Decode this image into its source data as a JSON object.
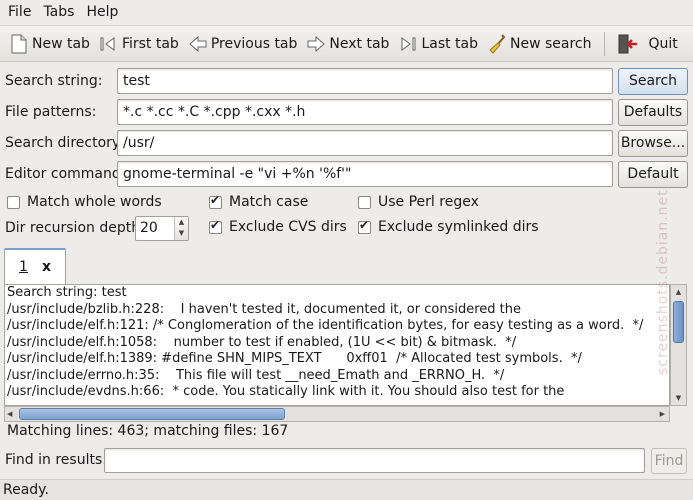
{
  "menubar": {
    "items": [
      {
        "label": "File"
      },
      {
        "label": "Tabs"
      },
      {
        "label": "Help"
      }
    ]
  },
  "toolbar": {
    "new_tab": "New tab",
    "first_tab": "First tab",
    "previous_tab": "Previous tab",
    "next_tab": "Next tab",
    "last_tab": "Last tab",
    "new_search": "New search",
    "quit": "Quit"
  },
  "form": {
    "search_string_label": "Search string:",
    "search_string_value": "test",
    "search_button": "Search",
    "file_patterns_label": "File patterns:",
    "file_patterns_value": "*.c *.cc *.C *.cpp *.cxx *.h",
    "defaults_button": "Defaults",
    "search_directory_label": "Search directory:",
    "search_directory_value": "/usr/",
    "browse_button": "Browse...",
    "editor_command_label": "Editor command:",
    "editor_command_value": "gnome-terminal -e \"vi +%n '%f'\"",
    "default_button": "Default"
  },
  "options": {
    "match_whole_words": {
      "label": "Match whole words",
      "checked": false
    },
    "match_case": {
      "label": "Match case",
      "checked": true
    },
    "use_perl_regex": {
      "label": "Use Perl regex",
      "checked": false
    },
    "recursion_label": "Dir recursion depth:",
    "recursion_value": "20",
    "exclude_cvs": {
      "label": "Exclude CVS dirs",
      "checked": true
    },
    "exclude_symlinked": {
      "label": "Exclude symlinked dirs",
      "checked": true
    }
  },
  "tab": {
    "label": "1",
    "close": "x"
  },
  "results": {
    "lines": [
      "Search string: test",
      "/usr/include/bzlib.h:228:    I haven't tested it, documented it, or considered the",
      "/usr/include/elf.h:121: /* Conglomeration of the identification bytes, for easy testing as a word.  */",
      "/usr/include/elf.h:1058:    number to test if enabled, (1U << bit) & bitmask.  */",
      "/usr/include/elf.h:1389: #define SHN_MIPS_TEXT      0xff01  /* Allocated test symbols.  */",
      "/usr/include/errno.h:35:    This file will test __need_Emath and _ERRNO_H.  */",
      "/usr/include/evdns.h:66:  * code. You statically link with it. You should also test for the"
    ]
  },
  "summary": "Matching lines: 463; matching files: 167",
  "find": {
    "label": "Find in results:",
    "value": "",
    "button": "Find"
  },
  "status": "Ready.",
  "watermark": "screenshots.debian.net",
  "colors": {
    "accent": "#6b92c6",
    "window_bg": "#edeceb",
    "quit_red": "#c0202a"
  }
}
